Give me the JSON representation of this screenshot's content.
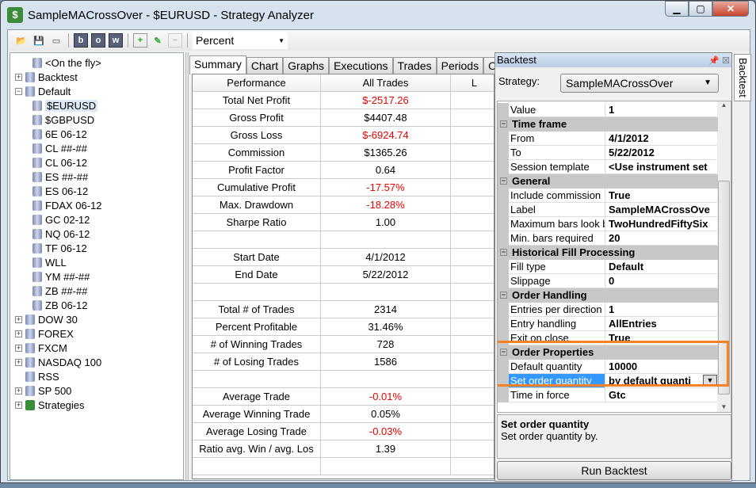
{
  "window": {
    "title": "SampleMACrossOver - $EURUSD - Strategy Analyzer"
  },
  "toolbar": {
    "display_unit": "Percent",
    "buttons": [
      "open",
      "save",
      "print",
      "b",
      "o",
      "w",
      "add",
      "edit",
      "remove"
    ]
  },
  "tree": [
    {
      "label": "<On the fly>",
      "level": 1,
      "expander": ""
    },
    {
      "label": "Backtest",
      "level": 0,
      "expander": "+"
    },
    {
      "label": "Default",
      "level": 0,
      "expander": "−"
    },
    {
      "label": "$EURUSD",
      "level": 1,
      "expander": "",
      "selected": true
    },
    {
      "label": "$GBPUSD",
      "level": 1,
      "expander": ""
    },
    {
      "label": "6E 06-12",
      "level": 1,
      "expander": ""
    },
    {
      "label": "CL ##-##",
      "level": 1,
      "expander": ""
    },
    {
      "label": "CL 06-12",
      "level": 1,
      "expander": ""
    },
    {
      "label": "ES ##-##",
      "level": 1,
      "expander": ""
    },
    {
      "label": "ES 06-12",
      "level": 1,
      "expander": ""
    },
    {
      "label": "FDAX 06-12",
      "level": 1,
      "expander": ""
    },
    {
      "label": "GC 02-12",
      "level": 1,
      "expander": ""
    },
    {
      "label": "NQ 06-12",
      "level": 1,
      "expander": ""
    },
    {
      "label": "TF 06-12",
      "level": 1,
      "expander": ""
    },
    {
      "label": "WLL",
      "level": 1,
      "expander": ""
    },
    {
      "label": "YM ##-##",
      "level": 1,
      "expander": ""
    },
    {
      "label": "ZB ##-##",
      "level": 1,
      "expander": ""
    },
    {
      "label": "ZB 06-12",
      "level": 1,
      "expander": ""
    },
    {
      "label": "DOW 30",
      "level": 0,
      "expander": "+"
    },
    {
      "label": "FOREX",
      "level": 0,
      "expander": "+"
    },
    {
      "label": "FXCM",
      "level": 0,
      "expander": "+"
    },
    {
      "label": "NASDAQ 100",
      "level": 0,
      "expander": "+"
    },
    {
      "label": "RSS",
      "level": 0,
      "expander": ""
    },
    {
      "label": "SP 500",
      "level": 0,
      "expander": "+"
    },
    {
      "label": "Strategies",
      "level": 0,
      "expander": "+",
      "icon": "strategy"
    }
  ],
  "tabs": [
    "Summary",
    "Chart",
    "Graphs",
    "Executions",
    "Trades",
    "Periods",
    "O"
  ],
  "grid": {
    "headers": [
      "Performance",
      "All Trades",
      "L"
    ],
    "rows": [
      [
        "Total Net Profit",
        "$-2517.26",
        true
      ],
      [
        "Gross Profit",
        "$4407.48",
        false
      ],
      [
        "Gross Loss",
        "$-6924.74",
        true
      ],
      [
        "Commission",
        "$1365.26",
        false
      ],
      [
        "Profit Factor",
        "0.64",
        false
      ],
      [
        "Cumulative Profit",
        "-17.57%",
        true
      ],
      [
        "Max. Drawdown",
        "-18.28%",
        true
      ],
      [
        "Sharpe Ratio",
        "1.00",
        false
      ],
      [
        "",
        "",
        false
      ],
      [
        "Start Date",
        "4/1/2012",
        false
      ],
      [
        "End Date",
        "5/22/2012",
        false
      ],
      [
        "",
        "",
        false
      ],
      [
        "Total # of Trades",
        "2314",
        false
      ],
      [
        "Percent Profitable",
        "31.46%",
        false
      ],
      [
        "# of Winning Trades",
        "728",
        false
      ],
      [
        "# of Losing Trades",
        "1586",
        false
      ],
      [
        "",
        "",
        false
      ],
      [
        "Average Trade",
        "-0.01%",
        true
      ],
      [
        "Average Winning Trade",
        "0.05%",
        false
      ],
      [
        "Average Losing Trade",
        "-0.03%",
        true
      ],
      [
        "Ratio avg. Win / avg. Los",
        "1.39",
        false
      ],
      [
        "",
        "",
        false
      ]
    ]
  },
  "panel": {
    "title": "Backtest",
    "strategy_label": "Strategy:",
    "strategy": "SampleMACrossOver",
    "props": [
      {
        "name": "Value",
        "value": "1"
      },
      {
        "cat": "Time frame"
      },
      {
        "name": "From",
        "value": "4/1/2012"
      },
      {
        "name": "To",
        "value": "5/22/2012"
      },
      {
        "name": "Session template",
        "value": "<Use instrument set"
      },
      {
        "cat": "General"
      },
      {
        "name": "Include commission",
        "value": "True"
      },
      {
        "name": "Label",
        "value": "SampleMACrossOve"
      },
      {
        "name": "Maximum bars look b",
        "value": "TwoHundredFiftySix"
      },
      {
        "name": "Min. bars required",
        "value": "20"
      },
      {
        "cat": "Historical Fill Processing"
      },
      {
        "name": "Fill type",
        "value": "Default"
      },
      {
        "name": "Slippage",
        "value": "0"
      },
      {
        "cat": "Order Handling"
      },
      {
        "name": "Entries per direction",
        "value": "1"
      },
      {
        "name": "Entry handling",
        "value": "AllEntries"
      },
      {
        "name": "Exit on close",
        "value": "True"
      },
      {
        "cat": "Order Properties"
      },
      {
        "name": "Default quantity",
        "value": "10000"
      },
      {
        "name": "Set order quantity",
        "value": "by default quanti",
        "selected": true
      },
      {
        "name": "Time in force",
        "value": "Gtc"
      }
    ],
    "desc_title": "Set order quantity",
    "desc_text": "Set order quantity by.",
    "run_label": "Run Backtest",
    "side_tab": "Backtest"
  },
  "colors": {
    "negative": "#e00000",
    "highlight": "#f5822a",
    "selection": "#3399ff"
  }
}
